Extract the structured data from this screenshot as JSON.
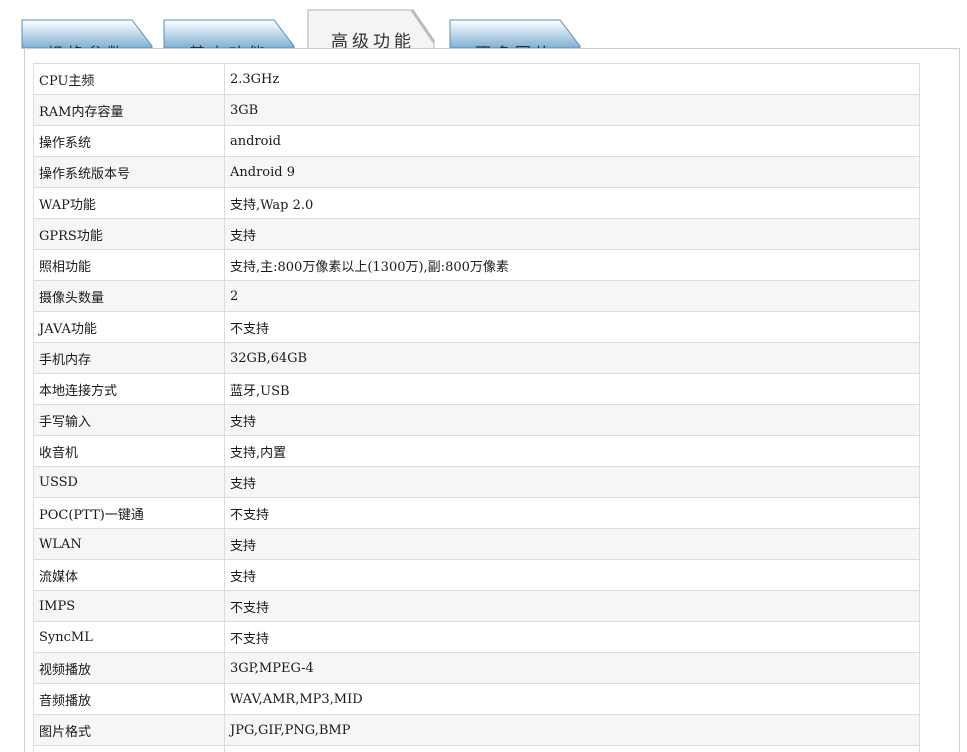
{
  "tabs": [
    {
      "label": "规格参数",
      "active": false
    },
    {
      "label": "基本功能",
      "active": false
    },
    {
      "label": "高级功能",
      "active": true
    },
    {
      "label": "更多图片",
      "active": false
    }
  ],
  "colors": {
    "tab_inactive_top": "#ffffff",
    "tab_inactive_bottom": "#7fb0d4",
    "tab_inactive_border": "#5a8db5",
    "tab_active_fill": "#f4f4f4",
    "tab_active_border": "#c9c9c9",
    "row_odd": "#f6f6f6",
    "row_even": "#ffffff",
    "grid_line": "#dcdcdc"
  },
  "specs": [
    {
      "name": "CPU主频",
      "value": "2.3GHz"
    },
    {
      "name": "RAM内存容量",
      "value": "3GB"
    },
    {
      "name": "操作系统",
      "value": "android"
    },
    {
      "name": "操作系统版本号",
      "value": "Android 9"
    },
    {
      "name": "WAP功能",
      "value": "支持,Wap 2.0"
    },
    {
      "name": "GPRS功能",
      "value": "支持"
    },
    {
      "name": "照相功能",
      "value": "支持,主:800万像素以上(1300万),副:800万像素"
    },
    {
      "name": "摄像头数量",
      "value": "2"
    },
    {
      "name": "JAVA功能",
      "value": "不支持"
    },
    {
      "name": "手机内存",
      "value": "32GB,64GB"
    },
    {
      "name": "本地连接方式",
      "value": "蓝牙,USB"
    },
    {
      "name": "手写输入",
      "value": "支持"
    },
    {
      "name": "收音机",
      "value": "支持,内置"
    },
    {
      "name": "USSD",
      "value": "支持"
    },
    {
      "name": "POC(PTT)一键通",
      "value": "不支持"
    },
    {
      "name": "WLAN",
      "value": "支持"
    },
    {
      "name": "流媒体",
      "value": "支持"
    },
    {
      "name": "IMPS",
      "value": "不支持"
    },
    {
      "name": "SyncML",
      "value": "不支持"
    },
    {
      "name": "视频播放",
      "value": "3GP,MPEG-4"
    },
    {
      "name": "音频播放",
      "value": "WAV,AMR,MP3,MID"
    },
    {
      "name": "图片格式",
      "value": "JPG,GIF,PNG,BMP"
    },
    {
      "name": "",
      "value": ""
    }
  ]
}
